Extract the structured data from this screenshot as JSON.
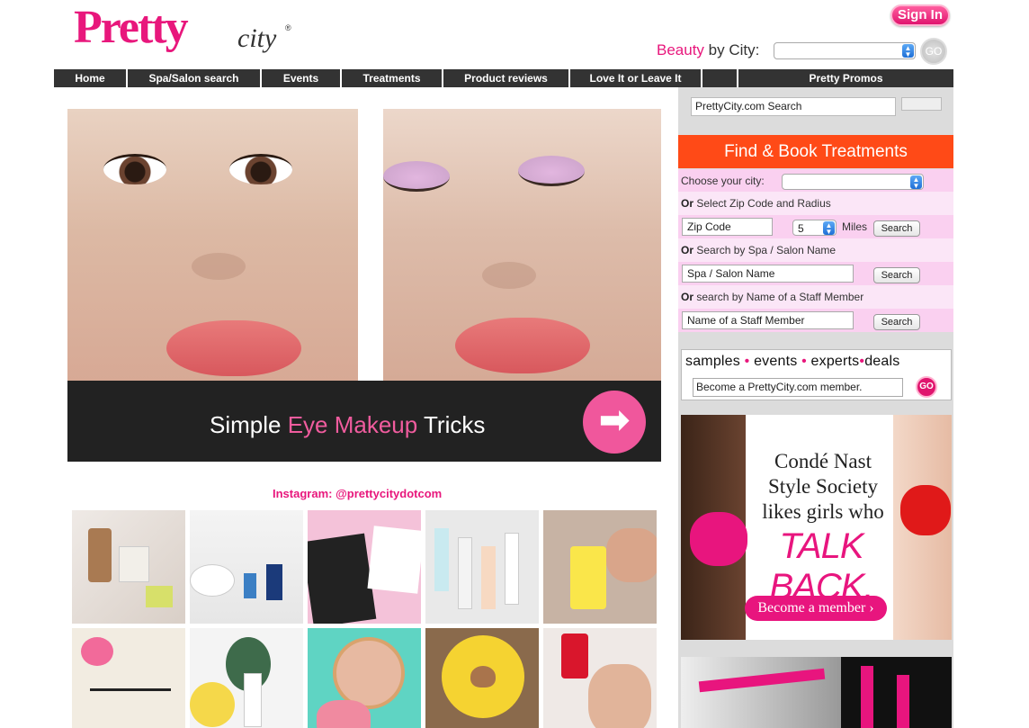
{
  "header": {
    "logo_pretty": "Pretty",
    "logo_city": "city",
    "logo_reg": "®",
    "signin_label": "Sign In",
    "beauty_word": "Beauty",
    "by_city_label": " by City:",
    "go_label": "GO"
  },
  "nav": {
    "items": [
      {
        "label": "Home"
      },
      {
        "label": "Spa/Salon search"
      },
      {
        "label": "Events"
      },
      {
        "label": "Treatments"
      },
      {
        "label": "Product reviews"
      },
      {
        "label": "Love It or Leave It"
      },
      {
        "label": ""
      },
      {
        "label": "Pretty Promos"
      }
    ]
  },
  "hero": {
    "text_before": "Simple ",
    "text_highlight": "Eye Makeup",
    "text_after": " Tricks",
    "arrow": "➡"
  },
  "instagram": {
    "title": "Instagram: @prettycitydotcom"
  },
  "sidebar": {
    "search_value": "PrettyCity.com  Search",
    "find_header": "Find & Book Treatments",
    "choose_city_label": "Choose your city:",
    "or_word": "Or",
    "zip_label": " Select Zip Code and Radius",
    "zip_placeholder": "Zip Code",
    "radius_value": "5",
    "miles_label": "Miles",
    "search_label": "Search",
    "spa_label": " Search by Spa / Salon Name",
    "spa_placeholder": "Spa / Salon Name",
    "staff_label": " search by Name of a Staff Member",
    "staff_placeholder": "Name of a Staff Member",
    "member_tags": [
      "samples",
      "events",
      "experts",
      "deals"
    ],
    "member_input": "Become a PrettyCity.com member.",
    "member_go": "GO"
  },
  "ad": {
    "line1": "Condé Nast",
    "line2": "Style Society",
    "line3": "likes girls who",
    "talk_back": "TALK BACK.",
    "button": "Become a member ›"
  },
  "colors": {
    "brand_pink": "#e8177c",
    "brand_orange": "#f08a1c",
    "find_orange": "#ff4a17",
    "nav_bg": "#333333",
    "row_pink": "#fad0f0"
  }
}
